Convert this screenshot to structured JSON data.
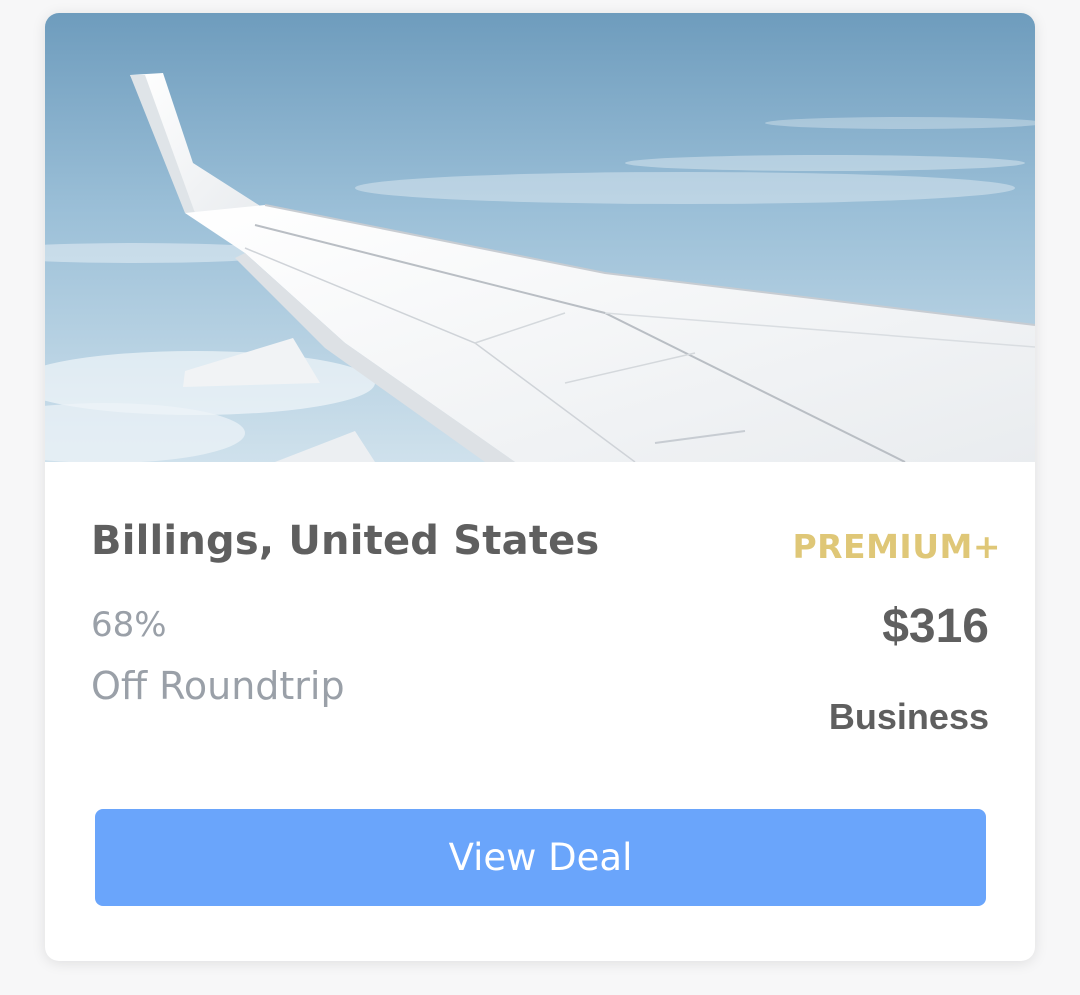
{
  "deal": {
    "destination": "Billings, United States",
    "tier": "PREMIUM+",
    "discount": "68%",
    "trip_type": "Off Roundtrip",
    "price": "$316",
    "cabin": "Business",
    "cta_label": "View Deal"
  },
  "colors": {
    "accent_button": "#6aa5fb",
    "tier_gold": "#dfc777",
    "heading_text": "#5f5f5f",
    "muted_text": "#9aa0a8"
  },
  "hero_image": {
    "subject": "airplane-wing-over-clouds"
  }
}
